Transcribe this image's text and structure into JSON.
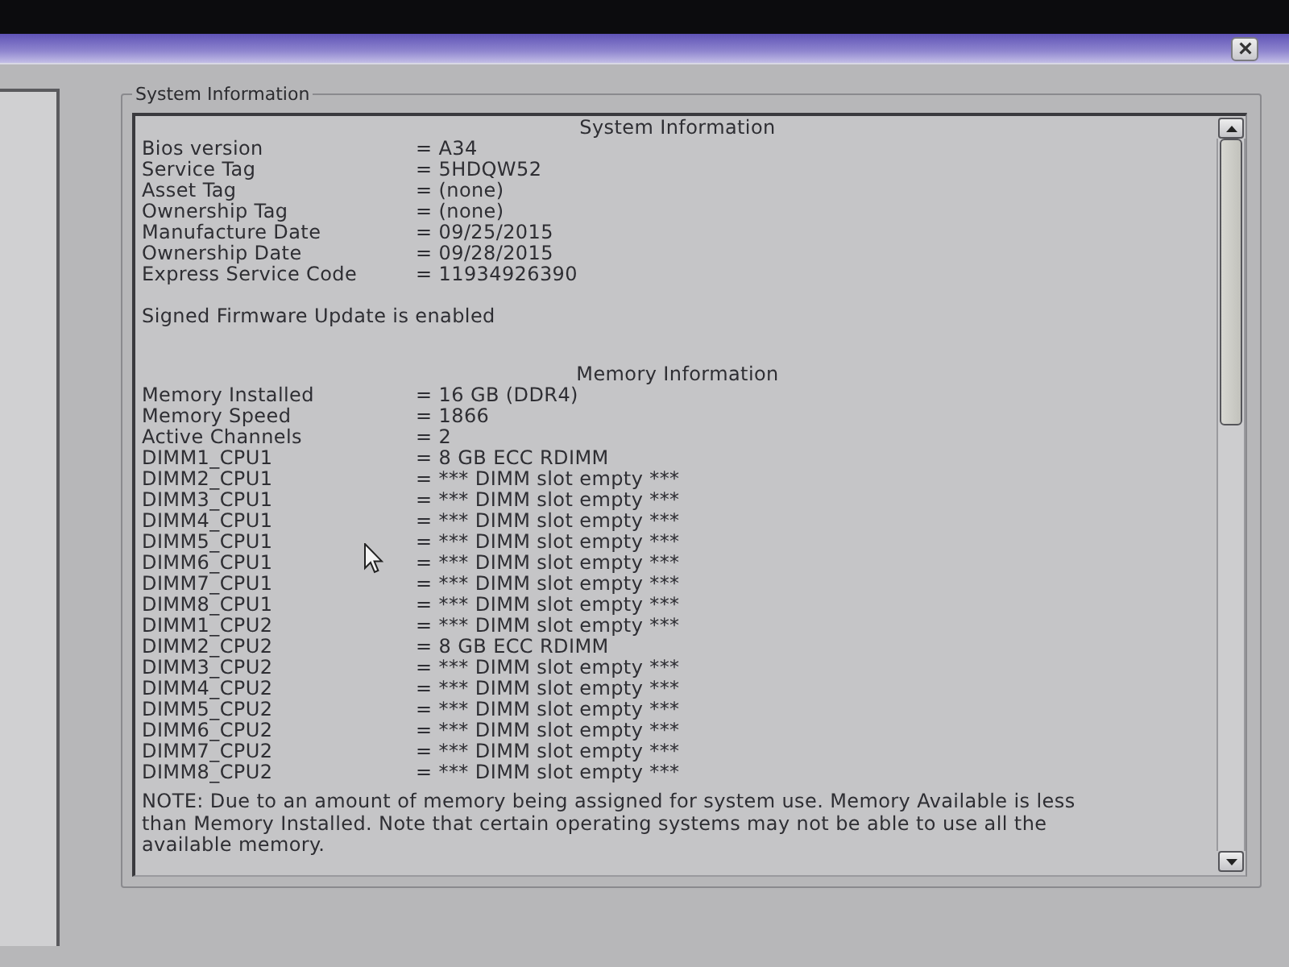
{
  "group_box": {
    "title": "System Information"
  },
  "system_information": {
    "heading": "System Information",
    "rows": [
      {
        "label": "Bios version",
        "value": "= A34"
      },
      {
        "label": "Service Tag",
        "value": "= 5HDQW52"
      },
      {
        "label": "Asset Tag",
        "value": "= (none)"
      },
      {
        "label": "Ownership Tag",
        "value": "= (none)"
      },
      {
        "label": "Manufacture Date",
        "value": "= 09/25/2015"
      },
      {
        "label": "Ownership Date",
        "value": "= 09/28/2015"
      },
      {
        "label": "Express Service Code",
        "value": "= 11934926390"
      }
    ]
  },
  "firmware_status": "Signed Firmware Update is enabled",
  "memory_information": {
    "heading": "Memory Information",
    "rows": [
      {
        "label": "Memory Installed",
        "value": "= 16 GB (DDR4)"
      },
      {
        "label": "Memory Speed",
        "value": "= 1866"
      },
      {
        "label": "Active Channels",
        "value": "= 2"
      },
      {
        "label": "DIMM1_CPU1",
        "value": "= 8 GB ECC RDIMM"
      },
      {
        "label": "DIMM2_CPU1",
        "value": "= *** DIMM slot empty ***"
      },
      {
        "label": "DIMM3_CPU1",
        "value": "= *** DIMM slot empty ***"
      },
      {
        "label": "DIMM4_CPU1",
        "value": "= *** DIMM slot empty ***"
      },
      {
        "label": "DIMM5_CPU1",
        "value": "= *** DIMM slot empty ***"
      },
      {
        "label": "DIMM6_CPU1",
        "value": "= *** DIMM slot empty ***"
      },
      {
        "label": "DIMM7_CPU1",
        "value": "= *** DIMM slot empty ***"
      },
      {
        "label": "DIMM8_CPU1",
        "value": "= *** DIMM slot empty ***"
      },
      {
        "label": "DIMM1_CPU2",
        "value": "= *** DIMM slot empty ***"
      },
      {
        "label": "DIMM2_CPU2",
        "value": "= 8 GB ECC RDIMM"
      },
      {
        "label": "DIMM3_CPU2",
        "value": "= *** DIMM slot empty ***"
      },
      {
        "label": "DIMM4_CPU2",
        "value": "= *** DIMM slot empty ***"
      },
      {
        "label": "DIMM5_CPU2",
        "value": "= *** DIMM slot empty ***"
      },
      {
        "label": "DIMM6_CPU2",
        "value": "= *** DIMM slot empty ***"
      },
      {
        "label": "DIMM7_CPU2",
        "value": "= *** DIMM slot empty ***"
      },
      {
        "label": "DIMM8_CPU2",
        "value": "= *** DIMM slot empty ***"
      }
    ]
  },
  "note": "NOTE: Due to an amount of memory being assigned for system use. Memory Available is less than Memory Installed. Note that certain operating systems may not be able to use all the available memory."
}
